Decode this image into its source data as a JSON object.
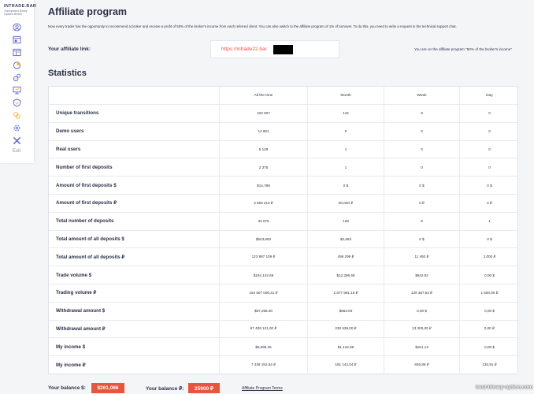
{
  "brand": {
    "name": "INTRADE.BAR",
    "tagline": "Transparent Binary Options Broker"
  },
  "sidebar": {
    "icons": [
      "user-icon",
      "window-icon",
      "browser-icon",
      "pie-chart-icon",
      "gears-icon",
      "monitor-icon",
      "shield-icon",
      "coins-icon",
      "settings-icon",
      "exit-icon"
    ],
    "exit_label": "Exit"
  },
  "page": {
    "title": "Affiliate program",
    "description": "Now every trader has the opportunity to recommend a broker and receive a profit of 50% of the broker's income from each referred client. You can also switch to the affiliate program of 1% of turnover. To do this, you need to write a request in the technical support chat."
  },
  "affiliate": {
    "label": "Your affiliate link:",
    "link": "https://intrade22.bar",
    "note": "You are on the affiliate program \"50% of the broker's income\""
  },
  "stats": {
    "title": "Statistics",
    "columns": [
      "All the time",
      "Month",
      "Week",
      "Day"
    ],
    "rows": [
      {
        "label": "Unique transitions",
        "values": [
          "223 007",
          "142",
          "9",
          "0"
        ]
      },
      {
        "label": "Demo users",
        "values": [
          "14 901",
          "0",
          "0",
          "0"
        ]
      },
      {
        "label": "Real users",
        "values": [
          "5 129",
          "1",
          "0",
          "0"
        ]
      },
      {
        "label": "Number of first deposits",
        "values": [
          "2 375",
          "1",
          "0",
          "0"
        ]
      },
      {
        "label": "Amount of first deposits $",
        "values": [
          "$14,789",
          "0 $",
          "0 $",
          "0 $"
        ]
      },
      {
        "label": "Amount of first deposits ₽",
        "values": [
          "3 668 213 ₽",
          "50,000 ₽",
          "0 ₽",
          "0 ₽"
        ]
      },
      {
        "label": "Total number of deposits",
        "values": [
          "33 078",
          "128",
          "9",
          "1"
        ]
      },
      {
        "label": "Total amount of all deposits $",
        "values": [
          "$523,893",
          "$2,683",
          "0 $",
          "0 $"
        ]
      },
      {
        "label": "Total amount of all deposits ₽",
        "values": [
          "123 887 109 ₽",
          "498 299 ₽",
          "11 460 ₽",
          "2,000 ₽"
        ]
      },
      {
        "label": "Trade volume $",
        "values": [
          "$194,142.66",
          "$12,296.69",
          "$642.92",
          "0,00 $"
        ]
      },
      {
        "label": "Trading volume ₽",
        "values": [
          "184 607 008,21 ₽",
          "2 877 991,16 ₽",
          "129 387,53 ₽",
          "1 500,00 ₽"
        ]
      },
      {
        "label": "Withdrawal amount $",
        "values": [
          "$57,268.00",
          "$663.00",
          "0,00 $",
          "0,00 $"
        ]
      },
      {
        "label": "Withdrawal amount ₽",
        "values": [
          "67 406 121,00 ₽",
          "230 538,00 ₽",
          "13 300,00 ₽",
          "0,00 ₽"
        ]
      },
      {
        "label": "My income $",
        "values": [
          "$6,895.25",
          "$1,142.89",
          "$161.13",
          "0,00 $"
        ]
      },
      {
        "label": "My income ₽",
        "values": [
          "7 438 152,54 ₽",
          "181 142,04 ₽",
          "836,88 ₽",
          "130,91 ₽"
        ]
      }
    ]
  },
  "footer": {
    "balance_usd_label": "Your balance $:",
    "balance_usd": "$261,066",
    "balance_rub_label": "Your balance ₽:",
    "balance_rub": "25900 ₽",
    "terms_link": "Affiliate Program Terms"
  },
  "watermark": "best-binary-option.com",
  "colors": {
    "accent": "#e8553f",
    "icon": "#5b63c9",
    "icon_secondary": "#f0b43c",
    "text": "#2b2f45"
  }
}
